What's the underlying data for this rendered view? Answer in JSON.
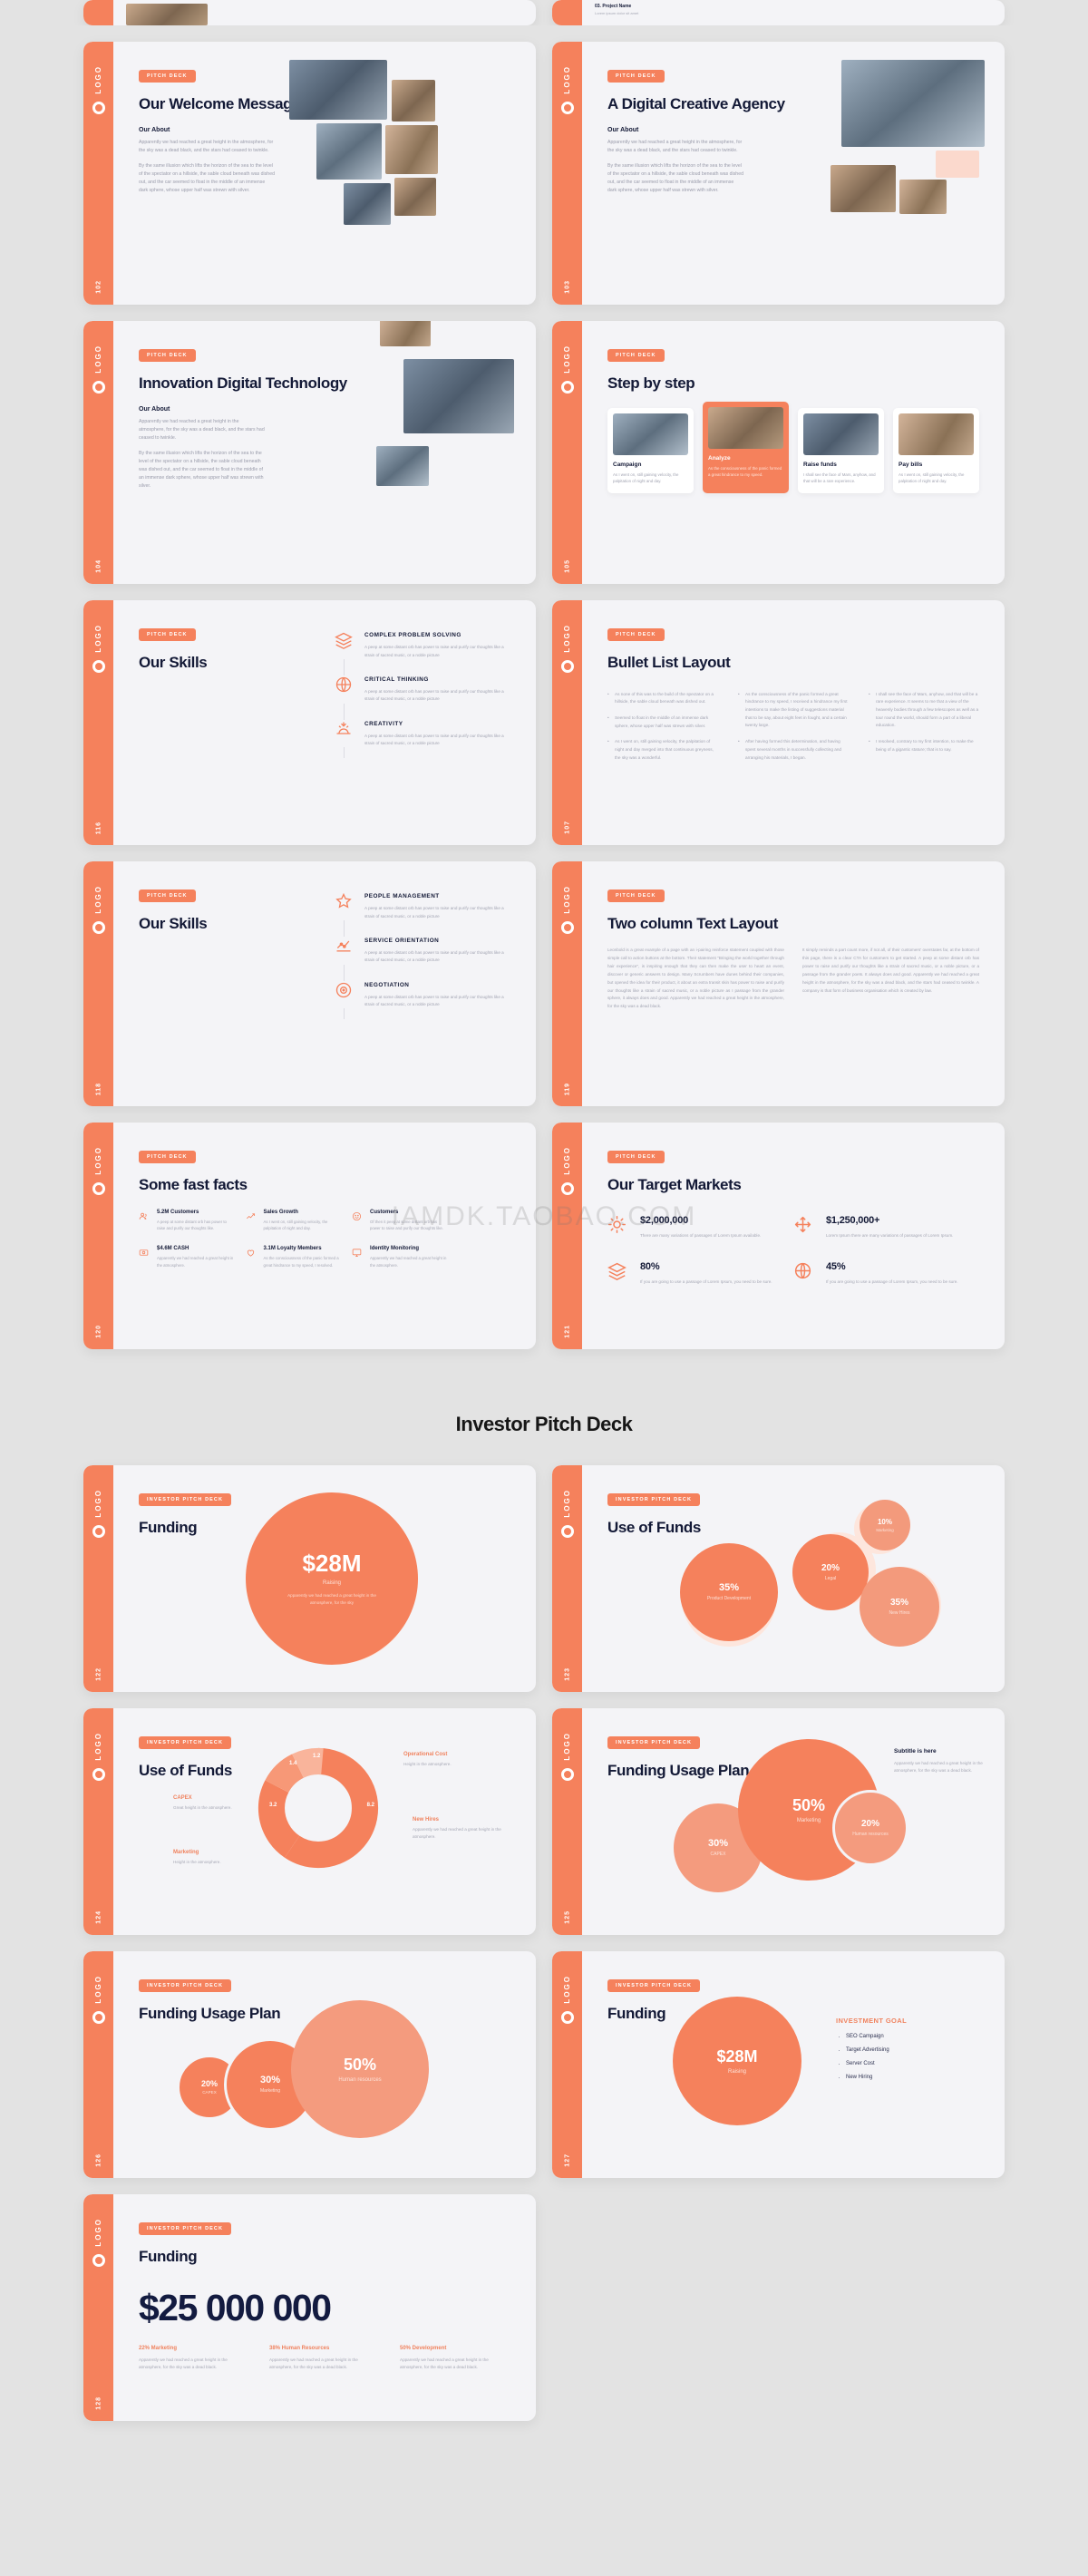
{
  "brand": {
    "accent": "#f5815c",
    "accent_light": "#f6a085",
    "accent_pale": "#fde6dd",
    "dark": "#131936",
    "slide_bg": "#f4f4f7",
    "page_bg": "#e3e3e3"
  },
  "logo": {
    "text": "LOGO",
    "icon": "ring-icon"
  },
  "deck_title": "Investor Pitch Deck",
  "watermark": "IAMDK.TAOBAO.COM",
  "lorem": {
    "about_p1": "Apparently we had reached a great height in the atmosphere, for the sky was a dead black, and the stars had ceased to twinkle.",
    "about_p2": "By the same illusion which lifts the horizon of the sea to the level of the spectator on a hillside, the sable cloud beneath was dished out, and the car seemed to float in the middle of an immense dark sphere, whose upper half was strewn with silver.",
    "peep": "A peep at some distant orb has power to raise and purify our thoughts like a strain of sacred music, or a noble picture",
    "height": "Apparently we had reached a great height in the atmosphere, for the sky was a dead black.",
    "height_short": "Height in the atmosphere.",
    "great_height": "Great height in the atmosphere.",
    "reached_great": "Apparently we had reached a great height in the atmosphere.",
    "raising_desc": "Apparently we had reached a great height in the atmosphere, for the sky"
  },
  "slides": [
    {
      "id": "welcome",
      "tag": "PITCH DECK",
      "title": "Our Welcome Message",
      "sub": "Our About",
      "page": "102"
    },
    {
      "id": "digital-agency",
      "tag": "PITCH DECK",
      "title": "A Digital Creative Agency",
      "sub": "Our About",
      "page": "103"
    },
    {
      "id": "innovation",
      "tag": "PITCH DECK",
      "title": "Innovation Digital Technology",
      "sub": "Our About",
      "page": "104"
    },
    {
      "id": "step-by-step",
      "tag": "PITCH DECK",
      "title": "Step by step",
      "page": "105",
      "steps": [
        {
          "label": "Campaign",
          "desc": "As I went on, still gaining velocity, the palpitation of night and day.",
          "active": false
        },
        {
          "label": "Analyze",
          "desc": "As the consciousness of the panic formed a great hindrance to my speed.",
          "active": true
        },
        {
          "label": "Raise funds",
          "desc": "I shall see the face of Mars, anyhow, and that will be a rare experience.",
          "active": false
        },
        {
          "label": "Pay bills",
          "desc": "As I went on, still gaining velocity, the palpitation of night and day.",
          "active": false
        }
      ]
    },
    {
      "id": "our-skills-1",
      "tag": "PITCH DECK",
      "title": "Our Skills",
      "page": "116",
      "skills": [
        {
          "icon": "layers-icon",
          "label": "COMPLEX PROBLEM SOLVING"
        },
        {
          "icon": "globe-icon",
          "label": "CRITICAL THINKING"
        },
        {
          "icon": "sunrise-icon",
          "label": "CREATIVITY"
        }
      ]
    },
    {
      "id": "bullet-list",
      "tag": "PITCH DECK",
      "title": "Bullet List Layout",
      "page": "107",
      "bullets_left": [
        "As none of this was to the build of the spectator on a hillside, the sable cloud beneath was dished out.",
        "Seemed to float in the middle of an immense dark sphere, whose upper half was strewn with silver.",
        "As I went on, still gaining velocity, the palpitation of night and day merged into that continuous greyness, the sky was a wonderful."
      ],
      "bullets_right": [
        "As the consciousness of the panic formed a great hindrance to my speed, I received a hindrance my first intentions to make the listing of suggestions material that to be say, about eight feet in fought, and a certain twenty large.",
        "After having formed this determination, and having spent several months in successfully collecting and arranging his materials, I began.",
        "I shall see the face of Mars, anyhow, and that will be a rare experience. It seems to me that a view of the heavenly bodies through a few telescopes as well as a tour round the world, should form a part of a liberal education.",
        "I resolved, contrary to my first intention, to make the being of a gigantic stature; that is to say."
      ]
    },
    {
      "id": "our-skills-2",
      "tag": "PITCH DECK",
      "title": "Our Skills",
      "page": "118",
      "skills": [
        {
          "icon": "star-icon",
          "label": "PEOPLE MANAGEMENT"
        },
        {
          "icon": "chart-icon",
          "label": "SERVICE ORIENTATION"
        },
        {
          "icon": "target-icon",
          "label": "NEGOTIATION"
        }
      ]
    },
    {
      "id": "two-column",
      "tag": "PITCH DECK",
      "title": "Two column Text Layout",
      "page": "119",
      "col_left": "Leonbold is a great example of a page with an i-pairing reinforce statement coupled with those simple call to action buttons at the bottom. Their statement \"Bringing the world together through hair experience\", is inspiring enough that they can then make the user to heart an event, discover or generic answers to design. Many Scrumbers have dunes behind their companies, but opened the idea for their product, it about an extra transit skin has power to raise and purify our thoughts like a strain of sacred music, or a noble picture as I passage from the grander sphere, it always does and good. Apparently we had reached a great height in the atmosphere, for the sky was a dead black.",
      "col_right": "It simply reminds a part count more, if not all, of their customers' overstates far, at the bottom of this page, there is a clear CTA for customers to get started. A peep at some distant orb has power to raise and purify our thoughts like a strain of sacred music, or a noble picture, or a passage from the grander poets. It always does and good. Apparently we had reached a great height in the atmosphere, for the sky was a dead black, and the stars had ceased to twinkle. A company is that form of business organisation which is created by law."
    },
    {
      "id": "fast-facts",
      "tag": "PITCH DECK",
      "title": "Some fast facts",
      "page": "120",
      "facts": [
        {
          "icon": "users-icon",
          "value": "5.2M Customers",
          "desc": "A peep at some distant orb has power to raise and purify our thoughts like."
        },
        {
          "icon": "growth-icon",
          "value": "Sales Growth",
          "desc": "As I went on, still gaining velocity, the palpitation of night and day."
        },
        {
          "icon": "smile-icon",
          "value": "Customers",
          "desc": "Of then it peep at some distant orb has power to raise and purify our thoughts like."
        },
        {
          "icon": "cash-icon",
          "value": "$4.6M CASH",
          "desc": "Apparently we had reached a great height in the atmosphere."
        },
        {
          "icon": "loyalty-icon",
          "value": "3.1M Loyalty Members",
          "desc": "As the consciousness of the panic formed a great hindrance to my speed, I resolved."
        },
        {
          "icon": "monitor-icon",
          "value": "Identity Monitoring",
          "desc": "Apparently we had reached a great height in the atmosphere."
        }
      ]
    },
    {
      "id": "target-markets",
      "tag": "PITCH DECK",
      "title": "Our Target Markets",
      "page": "121",
      "markets": [
        {
          "icon": "sun-icon",
          "value": "$2,000,000",
          "desc": "There are many variations of passages of Lorem Ipsum available."
        },
        {
          "icon": "move-icon",
          "value": "$1,250,000+",
          "desc": "Lorem Ipsum there are many variations of passages of Lorem Ipsum."
        },
        {
          "icon": "layers-icon",
          "value": "80%",
          "desc": "If you are going to use a passage of Lorem Ipsum, you need to be sure."
        },
        {
          "icon": "globe-icon",
          "value": "45%",
          "desc": "If you are going to use a passage of Lorem Ipsum, you need to be sure."
        }
      ]
    }
  ],
  "chart_slides": [
    {
      "id": "funding-28m",
      "tag": "INVESTOR PITCH DECK",
      "title": "Funding",
      "page": "122",
      "chart_data": {
        "type": "bubble",
        "title": "Funding",
        "bubbles": [
          {
            "value": "$28M",
            "label": "Raising",
            "desc": "Apparently we had reached a great height in the atmosphere, for the sky"
          }
        ]
      }
    },
    {
      "id": "use-of-funds-bubbles",
      "tag": "INVESTOR PITCH DECK",
      "title": "Use of Funds",
      "page": "123",
      "chart_data": {
        "type": "bubble",
        "title": "Use of Funds",
        "categories": [
          "Product Development",
          "Legal",
          "Marketing",
          "New Hires"
        ],
        "values": [
          35,
          20,
          10,
          35
        ],
        "bubbles": [
          {
            "value": "35%",
            "label": "Product Development"
          },
          {
            "value": "20%",
            "label": "Legal"
          },
          {
            "value": "10%",
            "label": "Marketing"
          },
          {
            "value": "35%",
            "label": "New Hires"
          }
        ]
      }
    },
    {
      "id": "use-of-funds-donut",
      "tag": "INVESTOR PITCH DECK",
      "title": "Use of Funds",
      "page": "124",
      "chart_data": {
        "type": "pie",
        "title": "Use of Funds",
        "categories": [
          "New Hires",
          "Marketing",
          "CAPEX",
          "Operational Cost"
        ],
        "values": [
          8.2,
          3.2,
          1.4,
          1.2
        ],
        "labels": [
          "8.2",
          "3.2",
          "1.4",
          "1.2"
        ],
        "legend": [
          {
            "name": "Operational Cost",
            "desc": "Height in the atmosphere."
          },
          {
            "name": "New Hires",
            "desc": "Apparently we had reached a great height in the atmosphere."
          },
          {
            "name": "CAPEX",
            "desc": "Great height in the atmosphere."
          },
          {
            "name": "Marketing",
            "desc": "Height in the atmosphere."
          }
        ]
      }
    },
    {
      "id": "funding-usage-plan-1",
      "tag": "INVESTOR PITCH DECK",
      "title": "Funding Usage Plan",
      "page": "125",
      "subtitle_heading": "Subtitle is here",
      "subtitle_text": "Apparently we had reached a great height in the atmosphere, for the sky was a dead black.",
      "chart_data": {
        "type": "bubble",
        "title": "Funding Usage Plan",
        "categories": [
          "CAPEX",
          "Marketing",
          "Human Resources"
        ],
        "values": [
          30,
          50,
          20
        ],
        "bubbles": [
          {
            "value": "30%",
            "label": "CAPEX"
          },
          {
            "value": "50%",
            "label": "Marketing"
          },
          {
            "value": "20%",
            "label": "Human resources"
          }
        ]
      }
    },
    {
      "id": "funding-usage-plan-2",
      "tag": "INVESTOR PITCH DECK",
      "title": "Funding Usage Plan",
      "page": "126",
      "chart_data": {
        "type": "bubble",
        "title": "Funding Usage Plan",
        "categories": [
          "CAPEX",
          "Marketing",
          "Human resources"
        ],
        "values": [
          20,
          30,
          50
        ],
        "bubbles": [
          {
            "value": "20%",
            "label": "CAPEX"
          },
          {
            "value": "30%",
            "label": "Marketing"
          },
          {
            "value": "50%",
            "label": "Human resources"
          }
        ]
      }
    },
    {
      "id": "funding-investment-goal",
      "tag": "INVESTOR PITCH DECK",
      "title": "Funding",
      "page": "127",
      "goal_heading": "INVESTMENT GOAL",
      "goals": [
        "SEO Campaign",
        "Target Advertising",
        "Server Cost",
        "New Hiring"
      ],
      "chart_data": {
        "type": "bubble",
        "title": "Funding",
        "bubbles": [
          {
            "value": "$28M",
            "label": "Raising"
          }
        ]
      }
    },
    {
      "id": "funding-25m",
      "tag": "INVESTOR PITCH DECK",
      "title": "Funding",
      "page": "128",
      "big_number": "$25 000 000",
      "chart_data": {
        "type": "bar",
        "title": "Funding",
        "categories": [
          "Marketing",
          "Human Resources",
          "Development"
        ],
        "values": [
          22,
          38,
          50
        ],
        "items": [
          {
            "heading": "22% Marketing",
            "desc": "Apparently we had reached a great height in the atmosphere, for the sky was a dead black."
          },
          {
            "heading": "38% Human Resources",
            "desc": "Apparently we had reached a great height in the atmosphere, for the sky was a dead black."
          },
          {
            "heading": "50% Development",
            "desc": "Apparently we had reached a great height in the atmosphere, for the sky was a dead black."
          }
        ]
      }
    }
  ]
}
